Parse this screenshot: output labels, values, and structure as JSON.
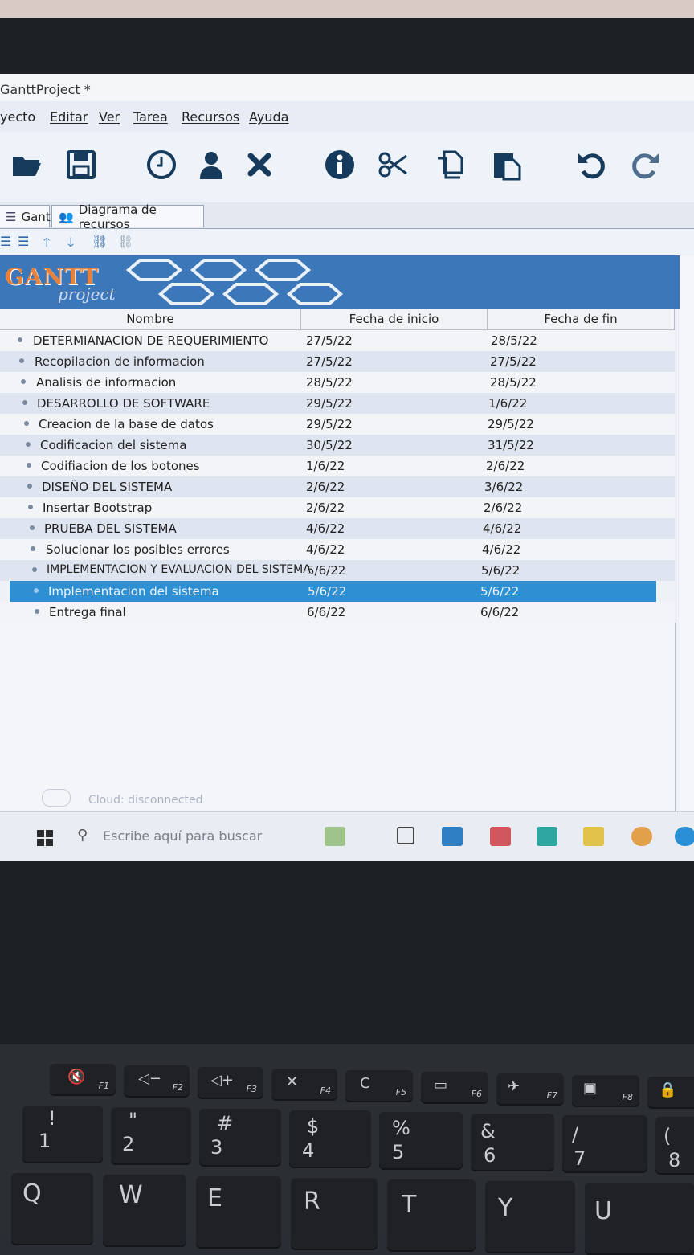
{
  "window": {
    "title": "GanttProject *"
  },
  "menu": [
    "yecto",
    "Editar",
    "Ver",
    "Tarea",
    "Recursos",
    "Ayuda"
  ],
  "toolbar_icons": [
    "open-folder-icon",
    "save-icon",
    "clock-icon",
    "person-icon",
    "delete-icon",
    "info-icon",
    "cut-icon",
    "copy-icon",
    "paste-icon",
    "undo-icon",
    "redo-icon"
  ],
  "tabs": {
    "gantt": "Gantt",
    "resources": "Diagrama de recursos"
  },
  "logo": {
    "main": "GANTT",
    "sub": "project"
  },
  "table": {
    "columns": {
      "name": "Nombre",
      "start": "Fecha de inicio",
      "end": "Fecha de fin"
    },
    "rows": [
      {
        "name": "DETERMIANACION DE REQUERIMIENTO",
        "start": "27/5/22",
        "end": "28/5/22"
      },
      {
        "name": "Recopilacion de informacion",
        "start": "27/5/22",
        "end": "27/5/22"
      },
      {
        "name": "Analisis de informacion",
        "start": "28/5/22",
        "end": "28/5/22"
      },
      {
        "name": "DESARROLLO DE SOFTWARE",
        "start": "29/5/22",
        "end": "1/6/22"
      },
      {
        "name": "Creacion de la base de datos",
        "start": "29/5/22",
        "end": "29/5/22"
      },
      {
        "name": "Codificacion del sistema",
        "start": "30/5/22",
        "end": "31/5/22"
      },
      {
        "name": "Codifiacion de los botones",
        "start": "1/6/22",
        "end": "2/6/22"
      },
      {
        "name": "DISEÑO DEL SISTEMA",
        "start": "2/6/22",
        "end": "3/6/22"
      },
      {
        "name": "Insertar Bootstrap",
        "start": "2/6/22",
        "end": "2/6/22"
      },
      {
        "name": "PRUEBA DEL SISTEMA",
        "start": "4/6/22",
        "end": "4/6/22"
      },
      {
        "name": "Solucionar los posibles errores",
        "start": "4/6/22",
        "end": "4/6/22"
      },
      {
        "name": "IMPLEMENTACION Y EVALUACION DEL SISTEMA",
        "start": "5/6/22",
        "end": "5/6/22"
      },
      {
        "name": "Implementacion del sistema",
        "start": "5/6/22",
        "end": "5/6/22",
        "selected": true
      },
      {
        "name": "Entrega final",
        "start": "6/6/22",
        "end": "6/6/22"
      }
    ]
  },
  "status": {
    "cloud": "Cloud: disconnected"
  },
  "taskbar": {
    "search_placeholder": "Escribe aquí para buscar"
  },
  "keyboard": {
    "fkeys": [
      "F1",
      "F2",
      "F3",
      "F4",
      "F5",
      "F6",
      "F7",
      "F8"
    ],
    "numbers": [
      {
        "top": "!",
        "main": "1"
      },
      {
        "top": "\"",
        "main": "2"
      },
      {
        "top": "#",
        "main": "3"
      },
      {
        "top": "$",
        "main": "4"
      },
      {
        "top": "%",
        "main": "5"
      },
      {
        "top": "&",
        "main": "6"
      },
      {
        "top": "/",
        "main": "7"
      },
      {
        "top": "(",
        "main": "8"
      }
    ],
    "letters": [
      "Q",
      "W",
      "E",
      "R",
      "T",
      "Y",
      "U"
    ]
  }
}
